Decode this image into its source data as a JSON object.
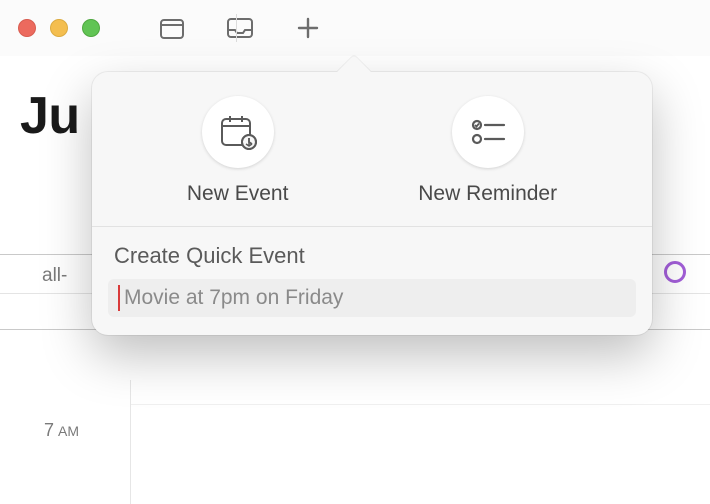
{
  "month_title": "Ju",
  "allday_label": "all-",
  "time_hour": "7",
  "time_ampm": "AM",
  "popover": {
    "new_event_label": "New Event",
    "new_reminder_label": "New Reminder",
    "section_title": "Create Quick Event",
    "placeholder": "Movie at 7pm on Friday"
  }
}
